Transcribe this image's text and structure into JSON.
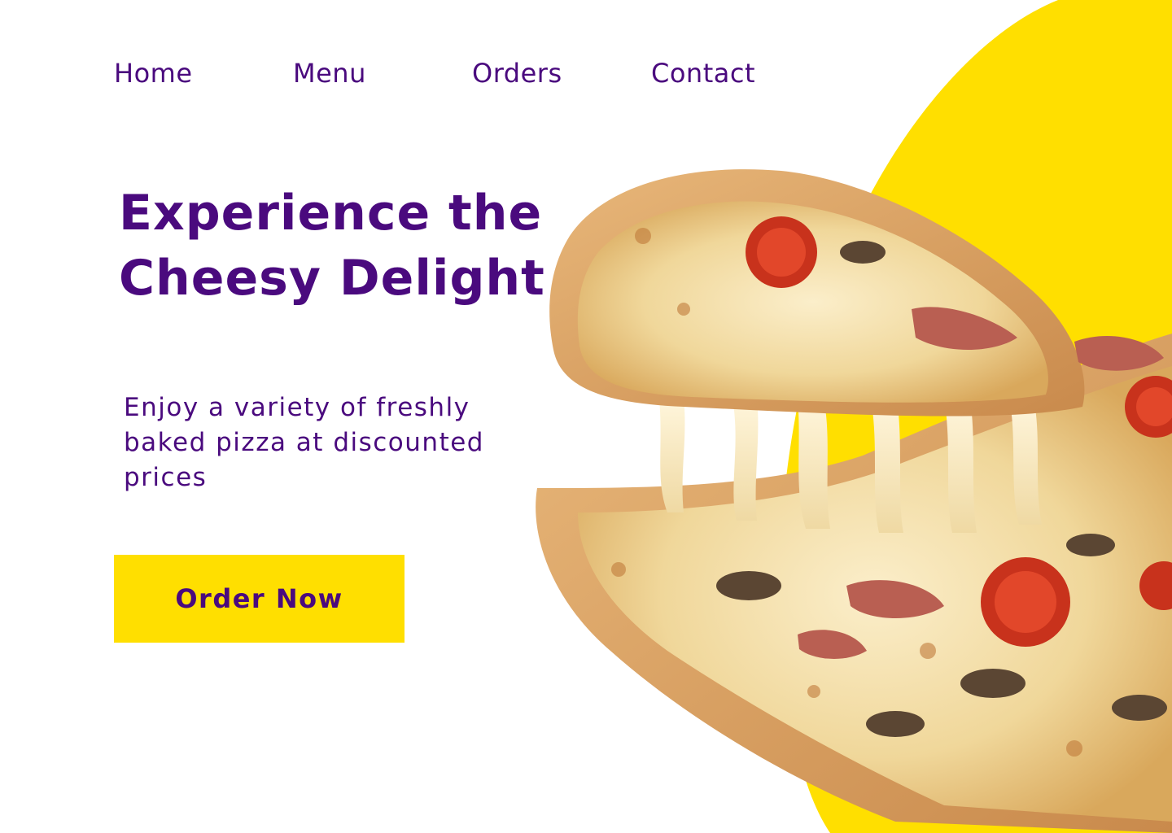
{
  "nav": {
    "items": [
      {
        "label": "Home"
      },
      {
        "label": "Menu"
      },
      {
        "label": "Orders"
      },
      {
        "label": "Contact"
      }
    ]
  },
  "hero": {
    "title": "Experience the Cheesy Delight",
    "title_line1": "Experience the",
    "title_line2": "Cheesy Delight",
    "subtitle_line1": "Enjoy a variety of freshly",
    "subtitle_line2": "baked pizza at discounted",
    "subtitle_line3": "prices",
    "cta_label": "Order Now"
  },
  "colors": {
    "brand_purple": "#4a0a7e",
    "accent_yellow": "#ffdf00",
    "background": "#ffffff"
  },
  "images": {
    "hero_image": "pizza-slice-cheese-pull"
  }
}
